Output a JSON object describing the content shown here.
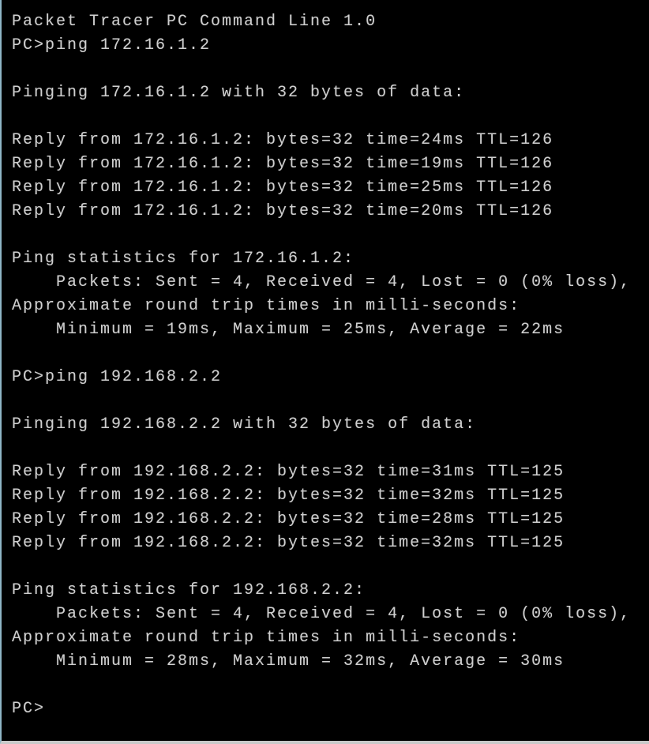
{
  "window": {
    "title": "Packet Tracer PC Command Line 1.0"
  },
  "colors": {
    "background": "#000000",
    "text": "#cfcfcf",
    "left_border": "#8fb6c6",
    "bottom_border": "#c9c9c9"
  },
  "session": {
    "lines": [
      {
        "type": "header",
        "text": "Packet Tracer PC Command Line 1.0"
      },
      {
        "type": "command",
        "text": "PC>ping 172.16.1.2"
      },
      {
        "type": "blank",
        "text": ""
      },
      {
        "type": "output",
        "text": "Pinging 172.16.1.2 with 32 bytes of data:"
      },
      {
        "type": "blank",
        "text": ""
      },
      {
        "type": "reply",
        "text": "Reply from 172.16.1.2: bytes=32 time=24ms TTL=126"
      },
      {
        "type": "reply",
        "text": "Reply from 172.16.1.2: bytes=32 time=19ms TTL=126"
      },
      {
        "type": "reply",
        "text": "Reply from 172.16.1.2: bytes=32 time=25ms TTL=126"
      },
      {
        "type": "reply",
        "text": "Reply from 172.16.1.2: bytes=32 time=20ms TTL=126"
      },
      {
        "type": "blank",
        "text": ""
      },
      {
        "type": "output",
        "text": "Ping statistics for 172.16.1.2:"
      },
      {
        "type": "output",
        "text": "    Packets: Sent = 4, Received = 4, Lost = 0 (0% loss),"
      },
      {
        "type": "output",
        "text": "Approximate round trip times in milli-seconds:"
      },
      {
        "type": "output",
        "text": "    Minimum = 19ms, Maximum = 25ms, Average = 22ms"
      },
      {
        "type": "blank",
        "text": ""
      },
      {
        "type": "command",
        "text": "PC>ping 192.168.2.2"
      },
      {
        "type": "blank",
        "text": ""
      },
      {
        "type": "output",
        "text": "Pinging 192.168.2.2 with 32 bytes of data:"
      },
      {
        "type": "blank",
        "text": ""
      },
      {
        "type": "reply",
        "text": "Reply from 192.168.2.2: bytes=32 time=31ms TTL=125"
      },
      {
        "type": "reply",
        "text": "Reply from 192.168.2.2: bytes=32 time=32ms TTL=125"
      },
      {
        "type": "reply",
        "text": "Reply from 192.168.2.2: bytes=32 time=28ms TTL=125"
      },
      {
        "type": "reply",
        "text": "Reply from 192.168.2.2: bytes=32 time=32ms TTL=125"
      },
      {
        "type": "blank",
        "text": ""
      },
      {
        "type": "output",
        "text": "Ping statistics for 192.168.2.2:"
      },
      {
        "type": "output",
        "text": "    Packets: Sent = 4, Received = 4, Lost = 0 (0% loss),"
      },
      {
        "type": "output",
        "text": "Approximate round trip times in milli-seconds:"
      },
      {
        "type": "output",
        "text": "    Minimum = 28ms, Maximum = 32ms, Average = 30ms"
      },
      {
        "type": "blank",
        "text": ""
      },
      {
        "type": "prompt",
        "text": "PC>"
      }
    ]
  }
}
